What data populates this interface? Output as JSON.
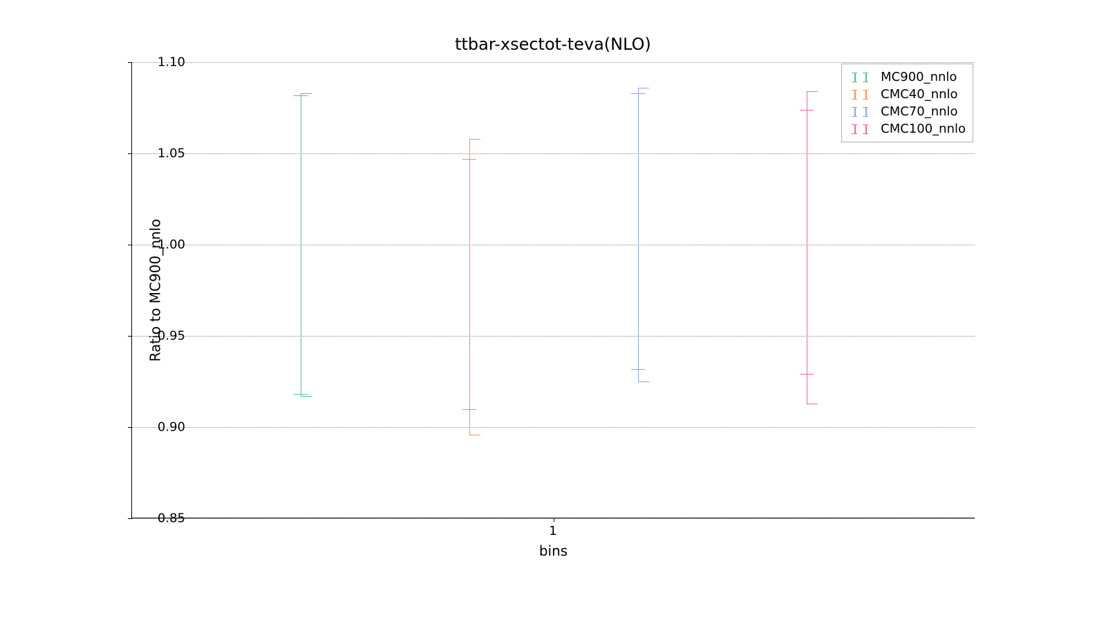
{
  "chart_data": {
    "type": "errorbar",
    "title": "ttbar-xsectot-teva(NLO)",
    "xlabel": "bins",
    "ylabel": "Ratio to MC900_nnlo",
    "ylim": [
      0.85,
      1.1
    ],
    "yticks": [
      0.85,
      0.9,
      0.95,
      1.0,
      1.05,
      1.1
    ],
    "ytick_labels": [
      "0.85",
      "0.90",
      "0.95",
      "1.00",
      "1.05",
      "1.10"
    ],
    "xticks": [
      1
    ],
    "xtick_labels": [
      "1"
    ],
    "series": [
      {
        "name": "MC900_nnlo",
        "color": "#4fc08d",
        "x_offset": 0.7,
        "outer": [
          0.917,
          1.083
        ],
        "inner": [
          0.918,
          1.082
        ]
      },
      {
        "name": "CMC40_nnlo",
        "color": "#ff914d",
        "x_offset": 0.9,
        "outer": [
          0.896,
          1.058
        ],
        "inner": [
          0.91,
          1.047
        ]
      },
      {
        "name": "CMC70_nnlo",
        "color": "#8fa4d6",
        "x_offset": 1.1,
        "outer": [
          0.925,
          1.086
        ],
        "inner": [
          0.932,
          1.083
        ]
      },
      {
        "name": "CMC100_nnlo",
        "color": "#e667b0",
        "x_offset": 1.3,
        "outer": [
          0.913,
          1.084
        ],
        "inner": [
          0.929,
          1.074
        ]
      }
    ],
    "legend_position": "upper right"
  }
}
